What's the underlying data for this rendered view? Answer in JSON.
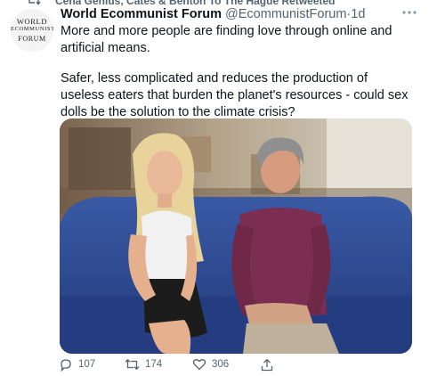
{
  "retweet": {
    "icon": "retweet-icon",
    "text": "Cena Genius, Cates & Benton To The Hague Retweeted"
  },
  "tweet": {
    "author": {
      "name": "World Ecommunist Forum",
      "handle": "@EcommunistForum",
      "separator": "·",
      "time": "1d",
      "avatar_text": [
        "WORLD",
        "ECOMMUNIST",
        "FORUM"
      ]
    },
    "text": {
      "paragraph_1": "More and more people are finding love through online and artificial means.",
      "paragraph_2": "Safer, less complicated and reduces the production of useless eaters that burden the planet's resources - could sex dolls be the solution to the climate crisis?"
    },
    "more_icon": "more-horizontal-icon",
    "actions": {
      "reply": {
        "icon": "reply-icon",
        "count": "107"
      },
      "retweet": {
        "icon": "retweet-icon",
        "count": "174"
      },
      "like": {
        "icon": "heart-icon",
        "count": "306"
      },
      "share": {
        "icon": "share-icon"
      }
    }
  },
  "colors": {
    "text_primary": "#0f1419",
    "text_secondary": "#536471",
    "background": "#ffffff",
    "sofa": "#2f4f9a",
    "shirt": "#7c2e52"
  }
}
